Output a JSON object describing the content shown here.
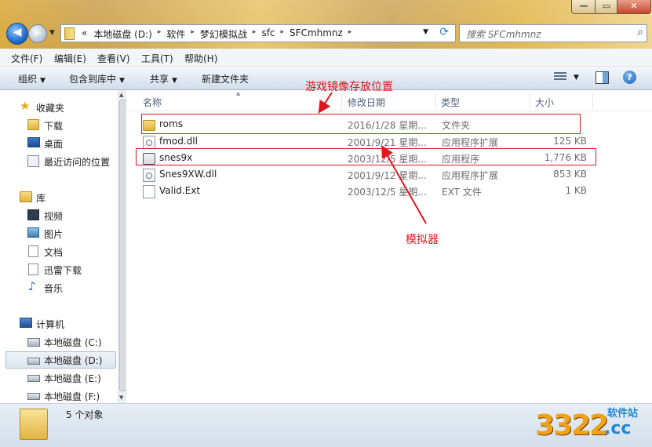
{
  "window": {
    "controls": {
      "minimize": "—",
      "maximize": "▭",
      "close": "✕"
    }
  },
  "nav": {
    "back_icon": "back-arrow-icon",
    "forward_icon": "forward-arrow-icon"
  },
  "address": {
    "overflow": "«",
    "crumbs": [
      "本地磁盘 (D:)",
      "软件",
      "梦幻模拟战",
      "sfc",
      "SFCmhmnz"
    ],
    "separator": "▸"
  },
  "search": {
    "placeholder": "搜索 SFCmhmnz"
  },
  "menu": [
    "文件(F)",
    "编辑(E)",
    "查看(V)",
    "工具(T)",
    "帮助(H)"
  ],
  "toolbar": {
    "organize": "组织",
    "include": "包含到库中",
    "share": "共享",
    "new_folder": "新建文件夹",
    "help": "?"
  },
  "sidebar": {
    "favorites": {
      "header": "收藏夹",
      "items": [
        "下载",
        "桌面",
        "最近访问的位置"
      ]
    },
    "libraries": {
      "header": "库",
      "items": [
        "视频",
        "图片",
        "文档",
        "迅雷下载",
        "音乐"
      ]
    },
    "computer": {
      "header": "计算机",
      "items": [
        "本地磁盘 (C:)",
        "本地磁盘 (D:)",
        "本地磁盘 (E:)",
        "本地磁盘 (F:)"
      ],
      "selected": "本地磁盘 (D:)"
    }
  },
  "columns": [
    "名称",
    "修改日期",
    "类型",
    "大小"
  ],
  "files": [
    {
      "name": "roms",
      "date": "2016/1/28 星期...",
      "type": "文件夹",
      "size": "",
      "icon": "folder-icon"
    },
    {
      "name": "fmod.dll",
      "date": "2001/9/21 星期...",
      "type": "应用程序扩展",
      "size": "125 KB",
      "icon": "dll-icon"
    },
    {
      "name": "snes9x",
      "date": "2003/12/5 星期...",
      "type": "应用程序",
      "size": "1,776 KB",
      "icon": "exe-icon"
    },
    {
      "name": "Snes9XW.dll",
      "date": "2001/9/12 星期...",
      "type": "应用程序扩展",
      "size": "853 KB",
      "icon": "dll-icon"
    },
    {
      "name": "Valid.Ext",
      "date": "2003/12/5 星期...",
      "type": "EXT 文件",
      "size": "1 KB",
      "icon": "file-icon"
    }
  ],
  "annotations": {
    "roms_note": "游戏镜像存放位置",
    "emulator_note": "模拟器",
    "color": "#e0161d"
  },
  "status": {
    "count": "5 个对象"
  },
  "watermark": {
    "number": "3322",
    "domain": ".cc",
    "label": "软件站"
  }
}
